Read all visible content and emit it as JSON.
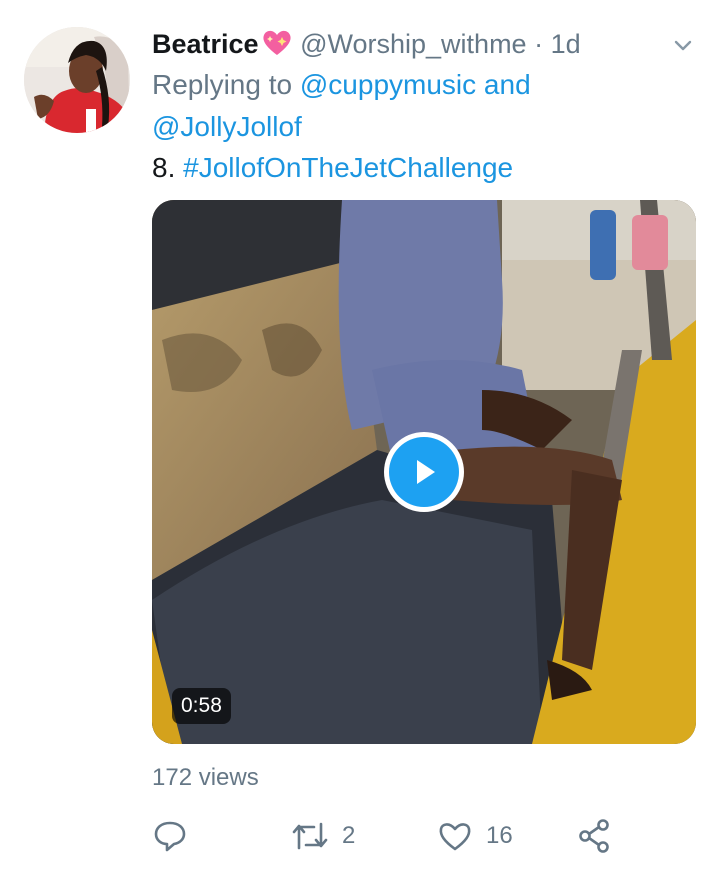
{
  "tweet": {
    "name": "Beatrice",
    "handle": "@Worship_withme",
    "separator": "·",
    "time": "1d",
    "reply_prefix": "Replying to",
    "reply_user1": "@cuppymusic",
    "reply_and": "and",
    "reply_user2": "@JollyJollof",
    "text_number": "8.",
    "hashtag": "#JollofOnTheJetChallenge"
  },
  "media": {
    "duration": "0:58",
    "views": "172 views"
  },
  "actions": {
    "retweets": "2",
    "likes": "16"
  },
  "colors": {
    "link": "#1b95e0",
    "muted": "#657786",
    "play": "#1da1f2"
  }
}
